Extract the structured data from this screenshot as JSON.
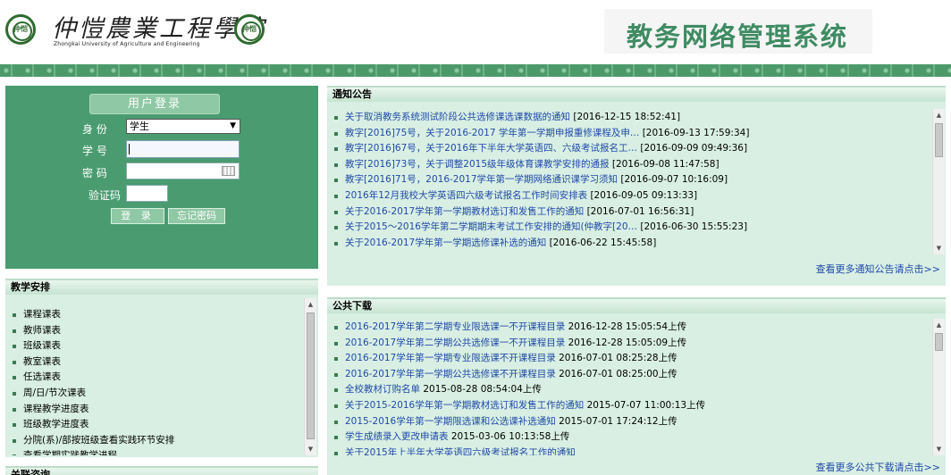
{
  "header": {
    "seal_text": "仲恺",
    "university_cn": "仲愷農業工程學院",
    "university_en": "Zhongkai University of Agriculture and Engineering",
    "system_title": "教务网络管理系统"
  },
  "login": {
    "title": "用户登录",
    "role_label": "身 份",
    "role_value": "学生",
    "id_label": "学 号",
    "id_value": "",
    "password_label": "密 码",
    "password_value": "",
    "captcha_label": "验证码",
    "captcha_value": "",
    "login_button": "登 录",
    "forgot_button": "忘记密码"
  },
  "teaching": {
    "title": "教学安排",
    "items": [
      {
        "label": "课程课表"
      },
      {
        "label": "教师课表"
      },
      {
        "label": "班级课表"
      },
      {
        "label": "教室课表"
      },
      {
        "label": "任选课表"
      },
      {
        "label": "周/日/节次课表"
      },
      {
        "label": "课程教学进度表"
      },
      {
        "label": "班级教学进度表"
      },
      {
        "label": "分院(系)/部按班级查看实践环节安排"
      },
      {
        "label": "查看学期实践教学进程"
      }
    ]
  },
  "next_section_title": "关联咨询",
  "notices": {
    "title": "通知公告",
    "items": [
      {
        "title": "关于取消教务系统测试阶段公共选修课选课数据的通知",
        "date": "[2016-12-15 18:52:41]"
      },
      {
        "title": "教字[2016]75号，关于2016-2017 学年第一学期申报重修课程及申…",
        "date": "[2016-09-13 17:59:34]"
      },
      {
        "title": "教字[2016]67号，关于2016年下半年大学英语四、六级考试报名工…",
        "date": "[2016-09-09 09:49:36]"
      },
      {
        "title": "教字[2016]73号，关于调整2015级年级体育课教学安排的通报",
        "date": "[2016-09-08 11:47:58]"
      },
      {
        "title": "教字[2016]71号，2016-2017学年第一学期网络通识课学习须知",
        "date": "[2016-09-07 10:16:09]"
      },
      {
        "title": "2016年12月我校大学英语四六级考试报名工作时间安排表",
        "date": "[2016-09-05 09:13:33]"
      },
      {
        "title": "关于2016-2017学年第一学期教材选订和发售工作的通知",
        "date": "[2016-07-01 16:56:31]"
      },
      {
        "title": "关于2015～2016学年第二学期期末考试工作安排的通知(仲教字[20…",
        "date": "[2016-06-30 15:55:23]"
      },
      {
        "title": "关于2016-2017学年第一学期选修课补选的通知",
        "date": "[2016-06-22 15:45:58]"
      }
    ],
    "more": "查看更多通知公告请点击>>"
  },
  "downloads": {
    "title": "公共下载",
    "items": [
      {
        "title": "2016-2017学年第二学期专业限选课一不开课程目录",
        "date": "2016-12-28 15:05:54上传"
      },
      {
        "title": "2016-2017学年第二学期公共选修课一不开课程目录",
        "date": "2016-12-28 15:05:09上传"
      },
      {
        "title": "2016-2017学年第一学期专业限选课不开课程目录",
        "date": "2016-07-01 08:25:28上传"
      },
      {
        "title": "2016-2017学年第一学期公共选修课不开课程目录",
        "date": "2016-07-01 08:25:00上传"
      },
      {
        "title": "全校教材订购名单",
        "date": "2015-08-28 08:54:04上传"
      },
      {
        "title": "关于2015-2016学年第一学期教材选订和发售工作的通知",
        "date": "2015-07-07 11:00:13上传"
      },
      {
        "title": "2015-2016学年第一学期限选课和公选课补选通知",
        "date": "2015-07-01 17:24:12上传"
      },
      {
        "title": "学生成绩录入更改申请表",
        "date": "2015-03-06 10:13:58上传"
      },
      {
        "title": "关于2015年上半年大学英语四六级考试报名工作的通知",
        "date": ""
      }
    ],
    "more": "查看更多公共下载请点击>>"
  },
  "icons": {
    "dropdown": "chevron-down-icon",
    "keyboard": "keyboard-icon",
    "scroll_up": "triangle-up-icon",
    "scroll_down": "triangle-down-icon"
  },
  "colors": {
    "brand_green": "#4a9c70",
    "panel_bg": "#d9efe3",
    "link_blue": "#1f4aa8",
    "title_green": "#3f8b62"
  }
}
